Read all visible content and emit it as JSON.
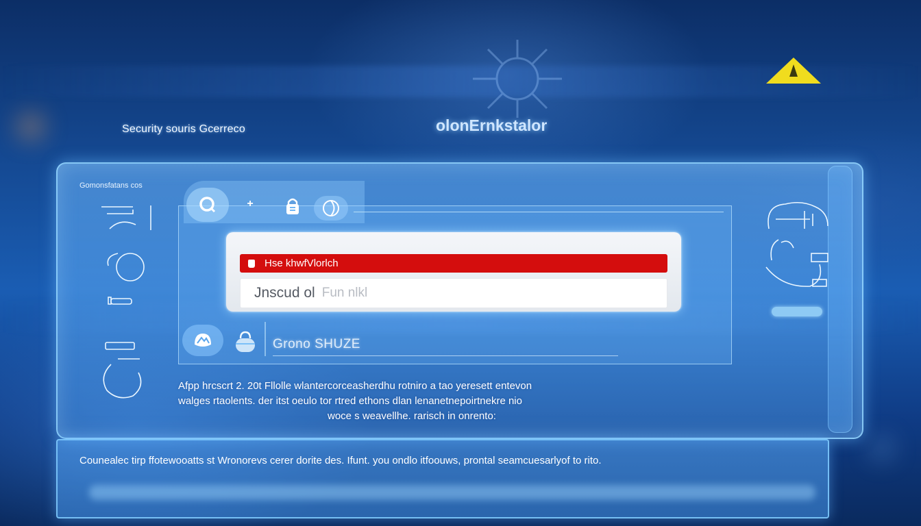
{
  "app_title": "Security souris Gcerreco",
  "brand": "olonErnkstalor",
  "sidebar": {
    "heading": "Gomonsfatans cos"
  },
  "dialog": {
    "alert_text": "Hse khwfVlorlch",
    "input_value": "Jnscud ol",
    "input_hint": "Fun nlkl"
  },
  "status": {
    "label": "Grono SHUZE"
  },
  "description": {
    "line1": "Afpp hrcscrt 2. 20t Fllolle  wlantercorceasherdhu rotniro a tao yeresett entevon",
    "line2": "walges rtaolents. der itst oeulo tor rtred ethons dlan lenanetnepoirtnekre nio",
    "line3": "woce s weavellhe. rarisch in onrento:"
  },
  "footer": {
    "text": "Counealec tirp ffotewooatts st Wronorevs cerer dorite des.  Ifunt. you ondlo itfoouws, prontal seamcuesarlyof  to rito."
  },
  "icons": {
    "toolbar": [
      "search-icon",
      "plus-icon",
      "lock-icon",
      "globe-icon"
    ],
    "bottom": [
      "shield-icon",
      "bag-icon"
    ],
    "decorative": [
      "virus-icon",
      "warning-icon",
      "person-icon"
    ]
  },
  "colors": {
    "alert_red": "#d40d0d",
    "warning_yellow": "#f0dc1e",
    "panel_blue": "#6eb9ff"
  }
}
